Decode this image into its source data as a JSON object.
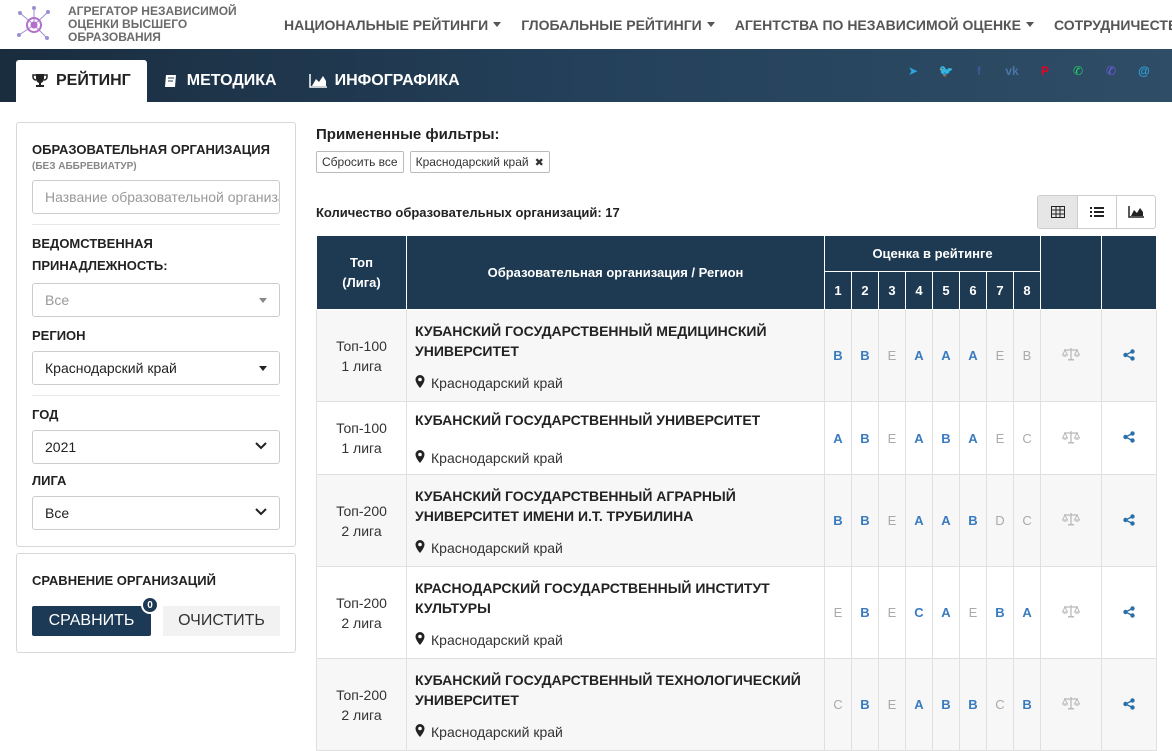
{
  "brand": {
    "text": "Агрегатор независимой оценки высшего образования"
  },
  "nav": [
    {
      "label": "НАЦИОНАЛЬНЫЕ РЕЙТИНГИ",
      "dropdown": true
    },
    {
      "label": "ГЛОБАЛЬНЫЕ РЕЙТИНГИ",
      "dropdown": true
    },
    {
      "label": "АГЕНТСТВА ПО НЕЗАВИСИМОЙ ОЦЕНКЕ",
      "dropdown": true
    },
    {
      "label": "СОТРУДНИЧЕСТВО",
      "dropdown": false
    }
  ],
  "tabs": [
    {
      "label": "РЕЙТИНГ",
      "icon": "trophy-icon",
      "active": true
    },
    {
      "label": "МЕТОДИКА",
      "icon": "book-icon",
      "active": false
    },
    {
      "label": "ИНФОГРАФИКА",
      "icon": "area-chart-icon",
      "active": false
    }
  ],
  "social": [
    {
      "icon": "telegram-icon",
      "glyph": "➤",
      "color": "#2ca5e0"
    },
    {
      "icon": "twitter-icon",
      "glyph": "🐦",
      "color": "#1da1f2"
    },
    {
      "icon": "facebook-icon",
      "glyph": "f",
      "color": "#3b5998"
    },
    {
      "icon": "vk-icon",
      "glyph": "vk",
      "color": "#4a76a8"
    },
    {
      "icon": "pinterest-icon",
      "glyph": "P",
      "color": "#e60023"
    },
    {
      "icon": "whatsapp-icon",
      "glyph": "✆",
      "color": "#25d366"
    },
    {
      "icon": "viber-icon",
      "glyph": "✆",
      "color": "#7360f2"
    },
    {
      "icon": "email-icon",
      "glyph": "@",
      "color": "#2ca5e0"
    }
  ],
  "filters": {
    "org_label": "ОБРАЗОВАТЕЛЬНАЯ ОРГАНИЗАЦИЯ",
    "org_sub": "(БЕЗ АББРЕВИАТУР)",
    "org_placeholder": "Название образовательной организации",
    "dept_label": "ВЕДОМСТВЕННАЯ ПРИНАДЛЕЖНОСТЬ:",
    "dept_value": "Все",
    "region_label": "РЕГИОН",
    "region_value": "Краснодарский край",
    "year_label": "ГОД",
    "year_value": "2021",
    "league_label": "ЛИГА",
    "league_value": "Все"
  },
  "compare": {
    "title": "СРАВНЕНИЕ ОРГАНИЗАЦИЙ",
    "compare_label": "СРАВНИТЬ",
    "badge": "0",
    "clear_label": "ОЧИСТИТЬ"
  },
  "applied": {
    "title": "Примененные фильтры:",
    "reset_label": "Сбросить все",
    "chip_label": "Краснодарский край"
  },
  "count_text": "Количество образовательных организаций: 17",
  "table": {
    "head_top": "Топ (Лига)",
    "head_org": "Образовательная организация / Регион",
    "head_score": "Оценка в рейтинге",
    "score_cols": [
      "1",
      "2",
      "3",
      "4",
      "5",
      "6",
      "7",
      "8"
    ],
    "rows": [
      {
        "top": "Топ-100",
        "league": "1 лига",
        "name": "КУБАНСКИЙ ГОСУДАРСТВЕННЫЙ МЕДИЦИНСКИЙ УНИВЕРСИТЕТ",
        "region": "Краснодарский край",
        "grades": [
          "B",
          "B",
          "E",
          "A",
          "A",
          "A",
          "E",
          "B"
        ],
        "strong": [
          1,
          1,
          0,
          1,
          1,
          1,
          0,
          0
        ]
      },
      {
        "top": "Топ-100",
        "league": "1 лига",
        "name": "КУБАНСКИЙ ГОСУДАРСТВЕННЫЙ УНИВЕРСИТЕТ",
        "region": "Краснодарский край",
        "grades": [
          "A",
          "B",
          "E",
          "A",
          "B",
          "A",
          "E",
          "C"
        ],
        "strong": [
          1,
          1,
          0,
          1,
          1,
          1,
          0,
          0
        ]
      },
      {
        "top": "Топ-200",
        "league": "2 лига",
        "name": "КУБАНСКИЙ ГОСУДАРСТВЕННЫЙ АГРАРНЫЙ УНИВЕРСИТЕТ ИМЕНИ И.Т. ТРУБИЛИНА",
        "region": "Краснодарский край",
        "grades": [
          "B",
          "B",
          "E",
          "A",
          "A",
          "B",
          "D",
          "C"
        ],
        "strong": [
          1,
          1,
          0,
          1,
          1,
          1,
          0,
          0
        ]
      },
      {
        "top": "Топ-200",
        "league": "2 лига",
        "name": "КРАСНОДАРСКИЙ ГОСУДАРСТВЕННЫЙ ИНСТИТУТ КУЛЬТУРЫ",
        "region": "Краснодарский край",
        "grades": [
          "E",
          "B",
          "E",
          "C",
          "A",
          "E",
          "B",
          "A"
        ],
        "strong": [
          0,
          1,
          0,
          1,
          1,
          0,
          1,
          1
        ]
      },
      {
        "top": "Топ-200",
        "league": "2 лига",
        "name": "КУБАНСКИЙ ГОСУДАРСТВЕННЫЙ ТЕХНОЛОГИЧЕСКИЙ УНИВЕРСИТЕТ",
        "region": "Краснодарский край",
        "grades": [
          "C",
          "B",
          "E",
          "A",
          "B",
          "B",
          "C",
          "B"
        ],
        "strong": [
          0,
          1,
          0,
          1,
          1,
          1,
          0,
          1
        ]
      }
    ]
  },
  "colors": {
    "header_dark": "#1e3a52",
    "grade_strong": "#3a7bbf",
    "grade_weak": "#aaaaaa"
  }
}
